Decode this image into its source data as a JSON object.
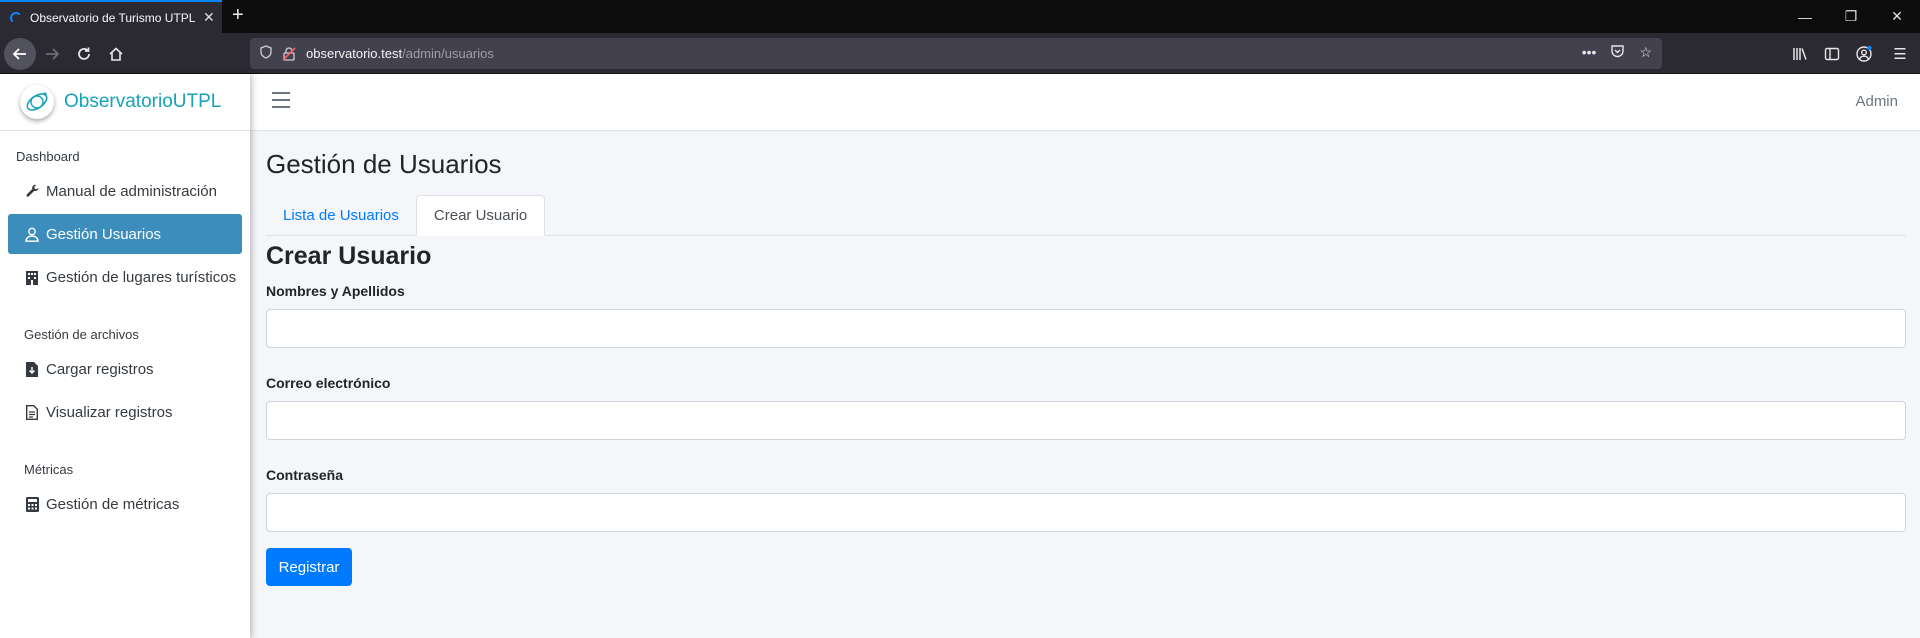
{
  "browser": {
    "tab_title": "Observatorio de Turismo UTPL",
    "url_host": "observatorio.test",
    "url_path": "/admin/usuarios",
    "tab_close_icon": "close-icon",
    "new_tab_icon": "plus-icon"
  },
  "app": {
    "brand_strong": "Observatorio",
    "brand_light": "UTPL",
    "admin_label": "Admin"
  },
  "sidebar": {
    "sections": [
      {
        "header": "Dashboard",
        "items": [
          {
            "label": "Manual de administración",
            "icon": "wrench-icon"
          },
          {
            "label": "Gestión Usuarios",
            "icon": "user-icon",
            "active": true
          },
          {
            "label": "Gestión de lugares turísticos",
            "icon": "building-icon"
          }
        ]
      },
      {
        "header": "Gestión de archivos",
        "items": [
          {
            "label": "Cargar registros",
            "icon": "file-download-icon"
          },
          {
            "label": "Visualizar registros",
            "icon": "file-text-icon"
          }
        ]
      },
      {
        "header": "Métricas",
        "items": [
          {
            "label": "Gestión de métricas",
            "icon": "calculator-icon"
          }
        ]
      }
    ]
  },
  "main": {
    "page_title": "Gestión de Usuarios",
    "tabs": [
      {
        "label": "Lista de Usuarios",
        "active": false
      },
      {
        "label": "Crear Usuario",
        "active": true
      }
    ],
    "form": {
      "title": "Crear Usuario",
      "fields": [
        {
          "label": "Nombres y Apellidos",
          "value": "",
          "placeholder": ""
        },
        {
          "label": "Correo electrónico",
          "value": "",
          "placeholder": ""
        },
        {
          "label": "Contraseña",
          "value": "",
          "placeholder": ""
        }
      ],
      "submit_label": "Registrar"
    }
  },
  "colors": {
    "accent": "#3c8dbc",
    "primary": "#007bff",
    "brand": "#17a2b8"
  }
}
